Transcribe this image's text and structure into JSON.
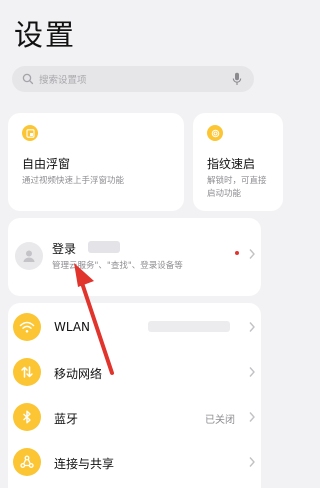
{
  "title": "设置",
  "search": {
    "placeholder": "搜索设置项"
  },
  "cards": [
    {
      "title": "自由浮窗",
      "desc": "通过视频快速上手浮窗功能"
    },
    {
      "title": "指纹速启",
      "desc": "解锁时，可直接启动功能"
    }
  ],
  "account": {
    "title": "登录",
    "desc": "管理云服务\"、\"查找\"、登录设备等"
  },
  "list": [
    {
      "label": "WLAN",
      "icon": "wifi-icon",
      "value": ""
    },
    {
      "label": "移动网络",
      "icon": "mobile-network-icon",
      "value": ""
    },
    {
      "label": "蓝牙",
      "icon": "bluetooth-icon",
      "value": "已关闭"
    },
    {
      "label": "连接与共享",
      "icon": "share-icon",
      "value": ""
    }
  ],
  "colors": {
    "accent": "#fbc534",
    "background": "#f2f2f4",
    "annotation_arrow": "#e0342c",
    "status_dot": "#e2342b"
  }
}
